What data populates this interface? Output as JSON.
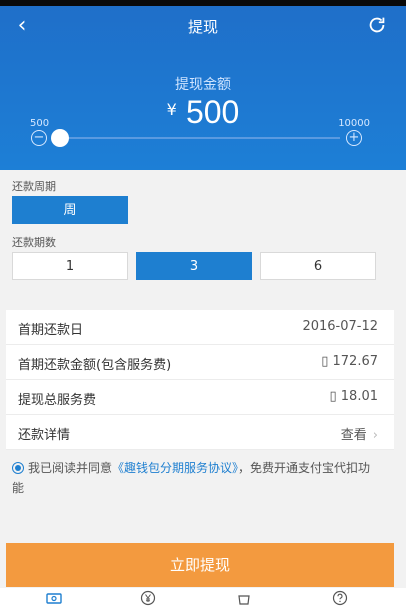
{
  "header": {
    "title": "提现"
  },
  "amount": {
    "title": "提现金额",
    "currency": "¥",
    "value": "500"
  },
  "slider": {
    "min": "500",
    "max": "10000",
    "current_fraction": 0.0
  },
  "repayment": {
    "period_label": "还款周期",
    "period_options": [
      "周"
    ],
    "count_label": "还款期数",
    "count_options": [
      "1",
      "3",
      "6"
    ],
    "count_selected": "3"
  },
  "info": {
    "rows": [
      {
        "label": "首期还款日",
        "value": "2016-07-12"
      },
      {
        "label": "首期还款金额(包含服务费)",
        "value": "▯ 172.67"
      },
      {
        "label": "提现总服务费",
        "value": "▯ 18.01"
      },
      {
        "label": "还款详情",
        "value": "查看"
      }
    ]
  },
  "agreement": {
    "prefix": "我已阅读并同意",
    "link": "《趣钱包分期服务协议》",
    "suffix": "，免费开通支付宝代扣功能"
  },
  "submit_label": "立即提现",
  "tabbar": {
    "icons": [
      "cash-icon",
      "yen-icon",
      "bag-icon",
      "help-icon"
    ]
  },
  "colors": {
    "primary": "#1e7fd0",
    "accent": "#f39a3f"
  }
}
